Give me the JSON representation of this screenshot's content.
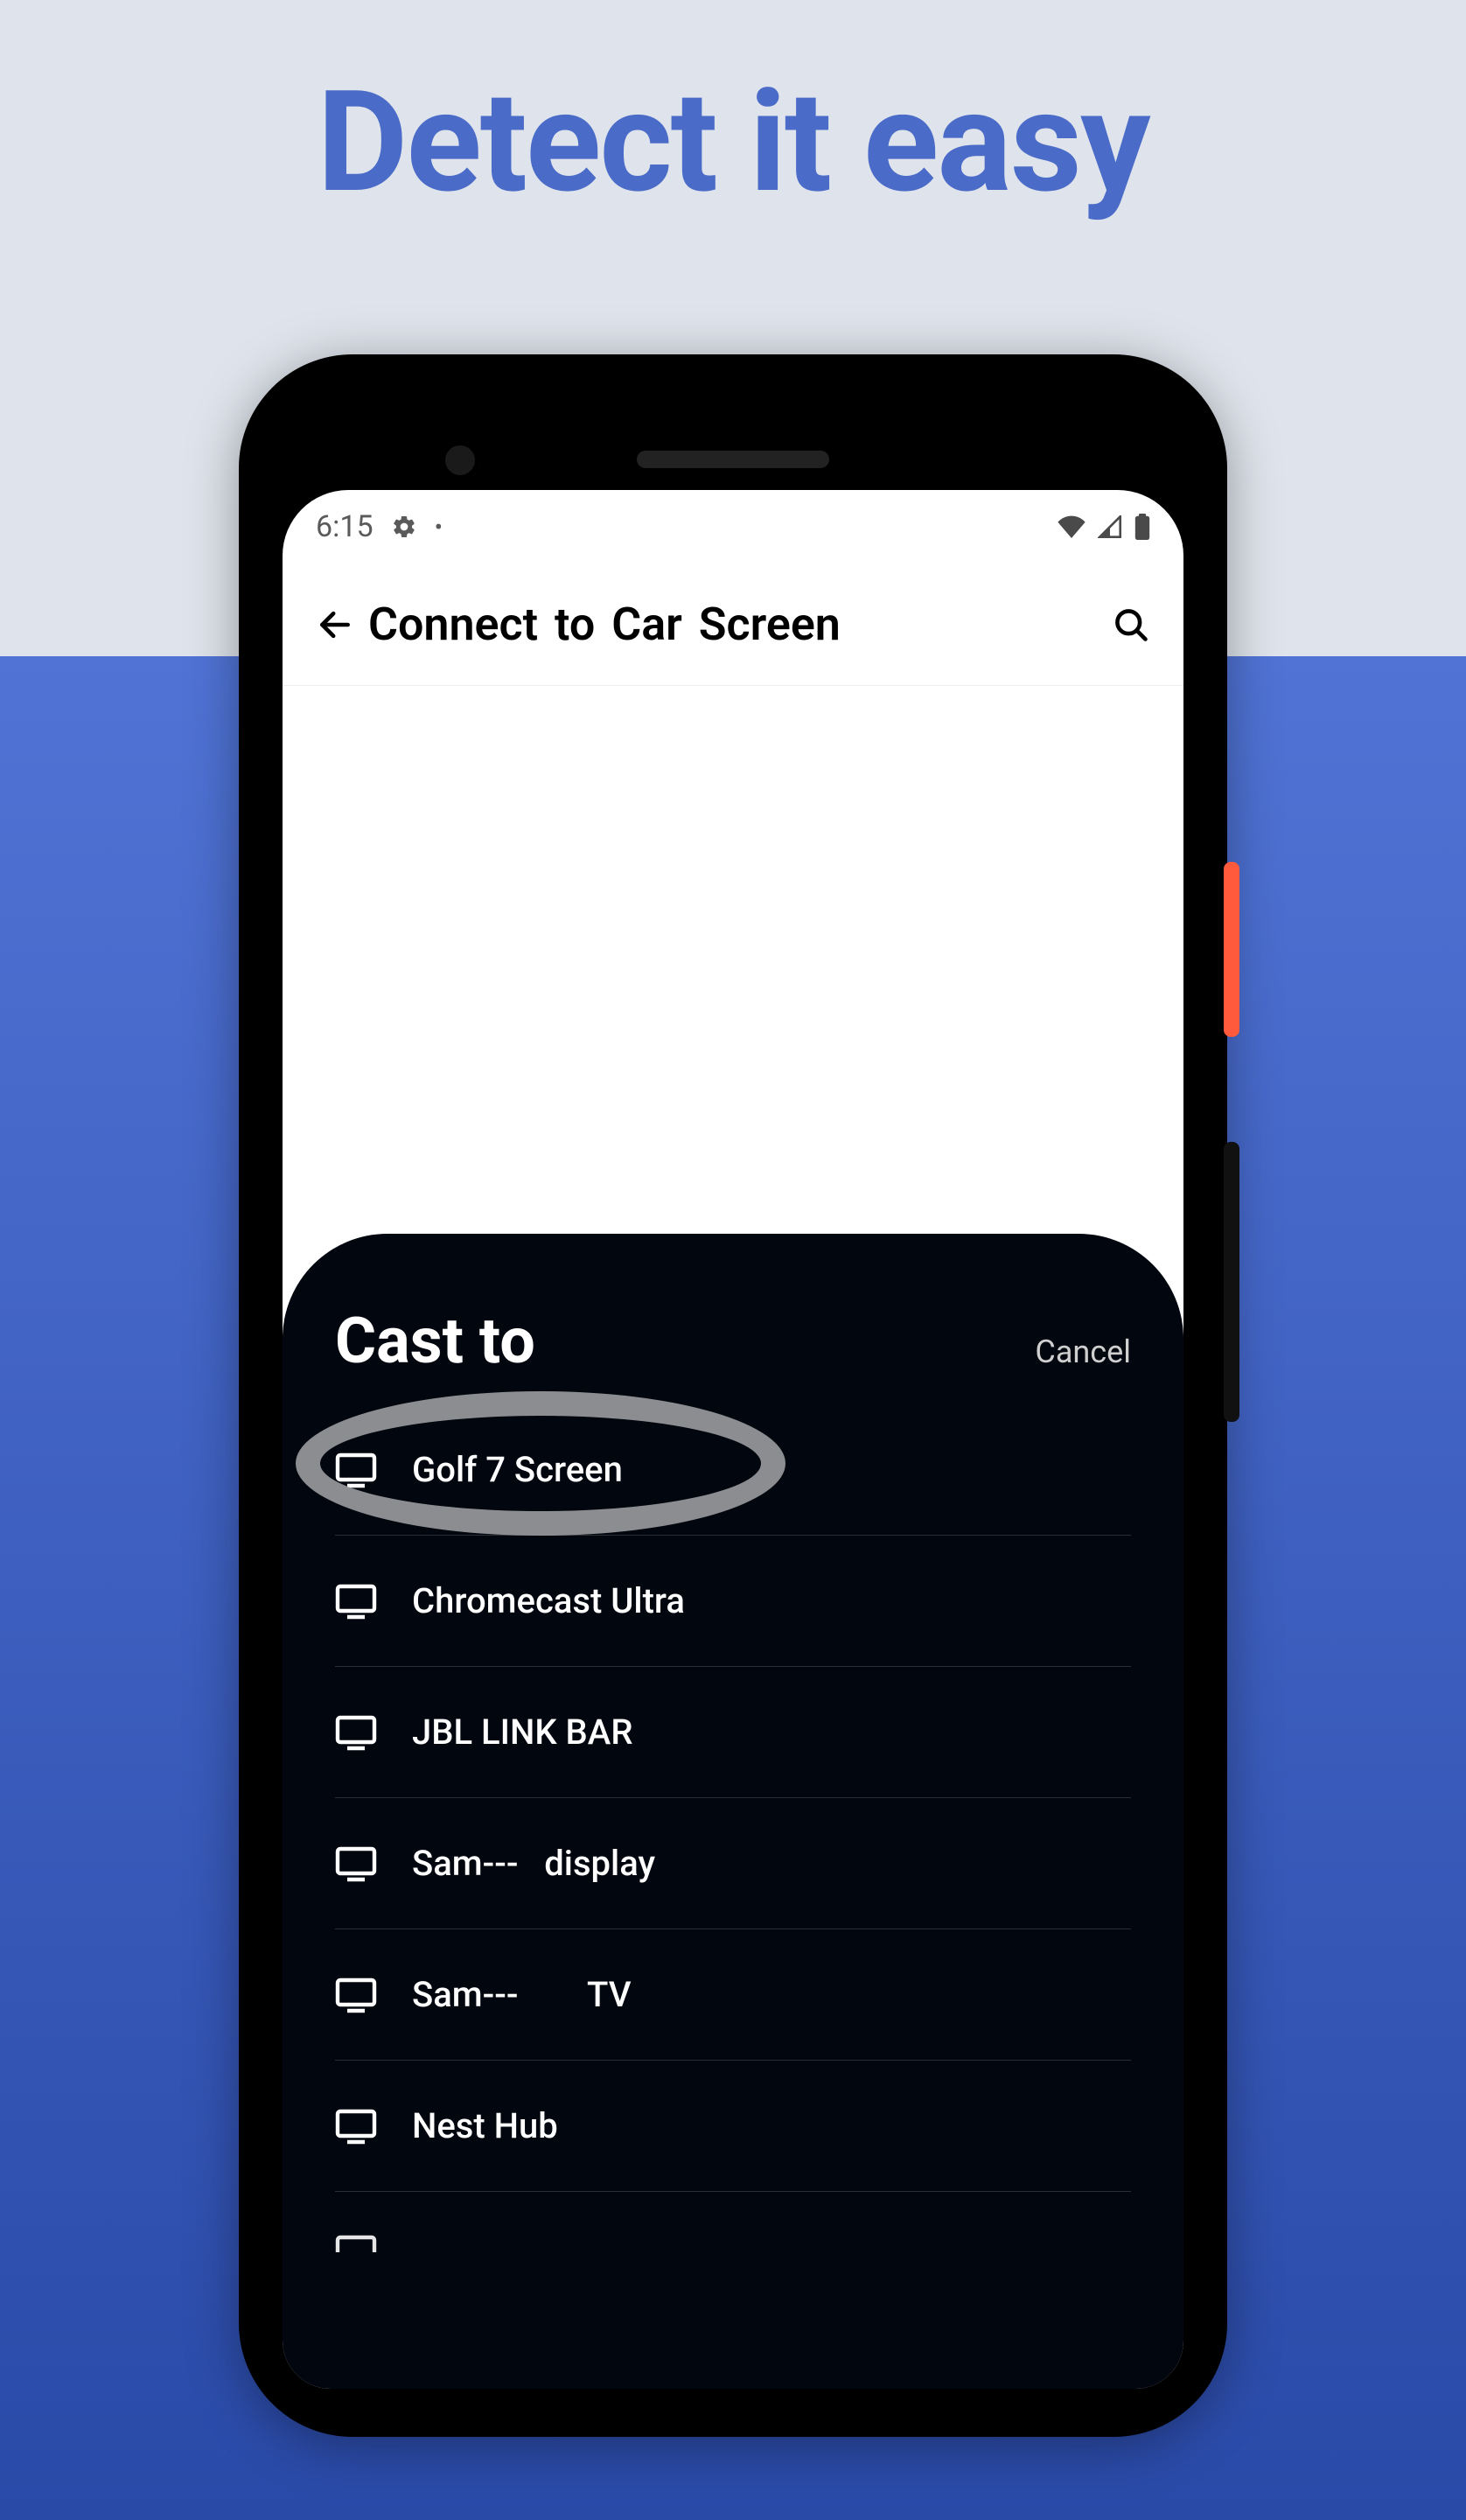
{
  "marketing": {
    "headline": "Detect it easy"
  },
  "status_bar": {
    "time": "6:15"
  },
  "app_bar": {
    "title": "Connect  to Car Screen"
  },
  "sheet": {
    "title": "Cast to",
    "cancel_label": "Cancel",
    "devices": [
      {
        "label": "Golf 7 Screen",
        "highlighted": true
      },
      {
        "label": "Chromecast Ultra"
      },
      {
        "label": "JBL LINK BAR"
      },
      {
        "label": "Sam---   display"
      },
      {
        "label": "Sam---        TV"
      },
      {
        "label": "Nest Hub"
      }
    ]
  }
}
